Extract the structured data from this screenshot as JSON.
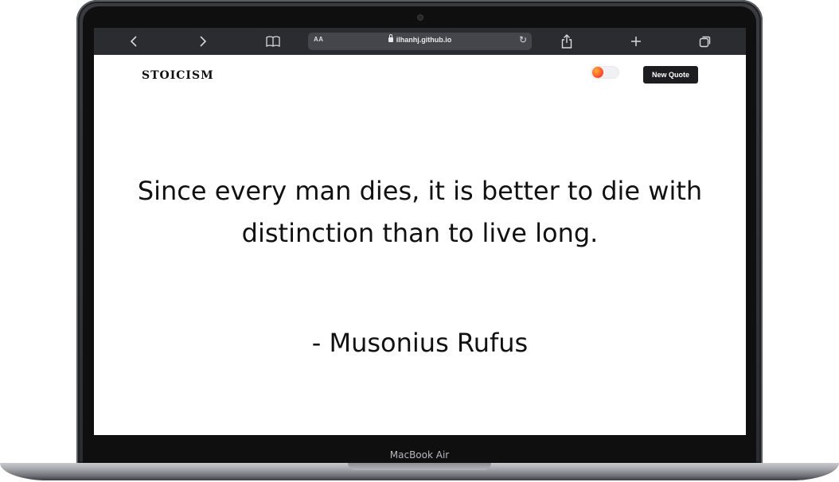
{
  "browser": {
    "back_icon": "chevron-left-icon",
    "forward_icon": "chevron-right-icon",
    "bookmarks_icon": "book-icon",
    "reader_label": "AA",
    "url": "ilhanhj.github.io",
    "reload_icon": "reload-icon",
    "share_icon": "share-icon",
    "new_tab_icon": "plus-icon",
    "tabs_icon": "tabs-icon"
  },
  "site": {
    "logo": "STOICISM",
    "theme_toggle_colors": [
      "#ffb13b",
      "#ff5a2b",
      "#e9284a"
    ],
    "new_quote_label": "New Quote"
  },
  "quote": {
    "text": "Since every man dies, it is better to die with distinction than to live long.",
    "author": "- Musonius Rufus"
  },
  "device": {
    "label": "MacBook Air"
  }
}
